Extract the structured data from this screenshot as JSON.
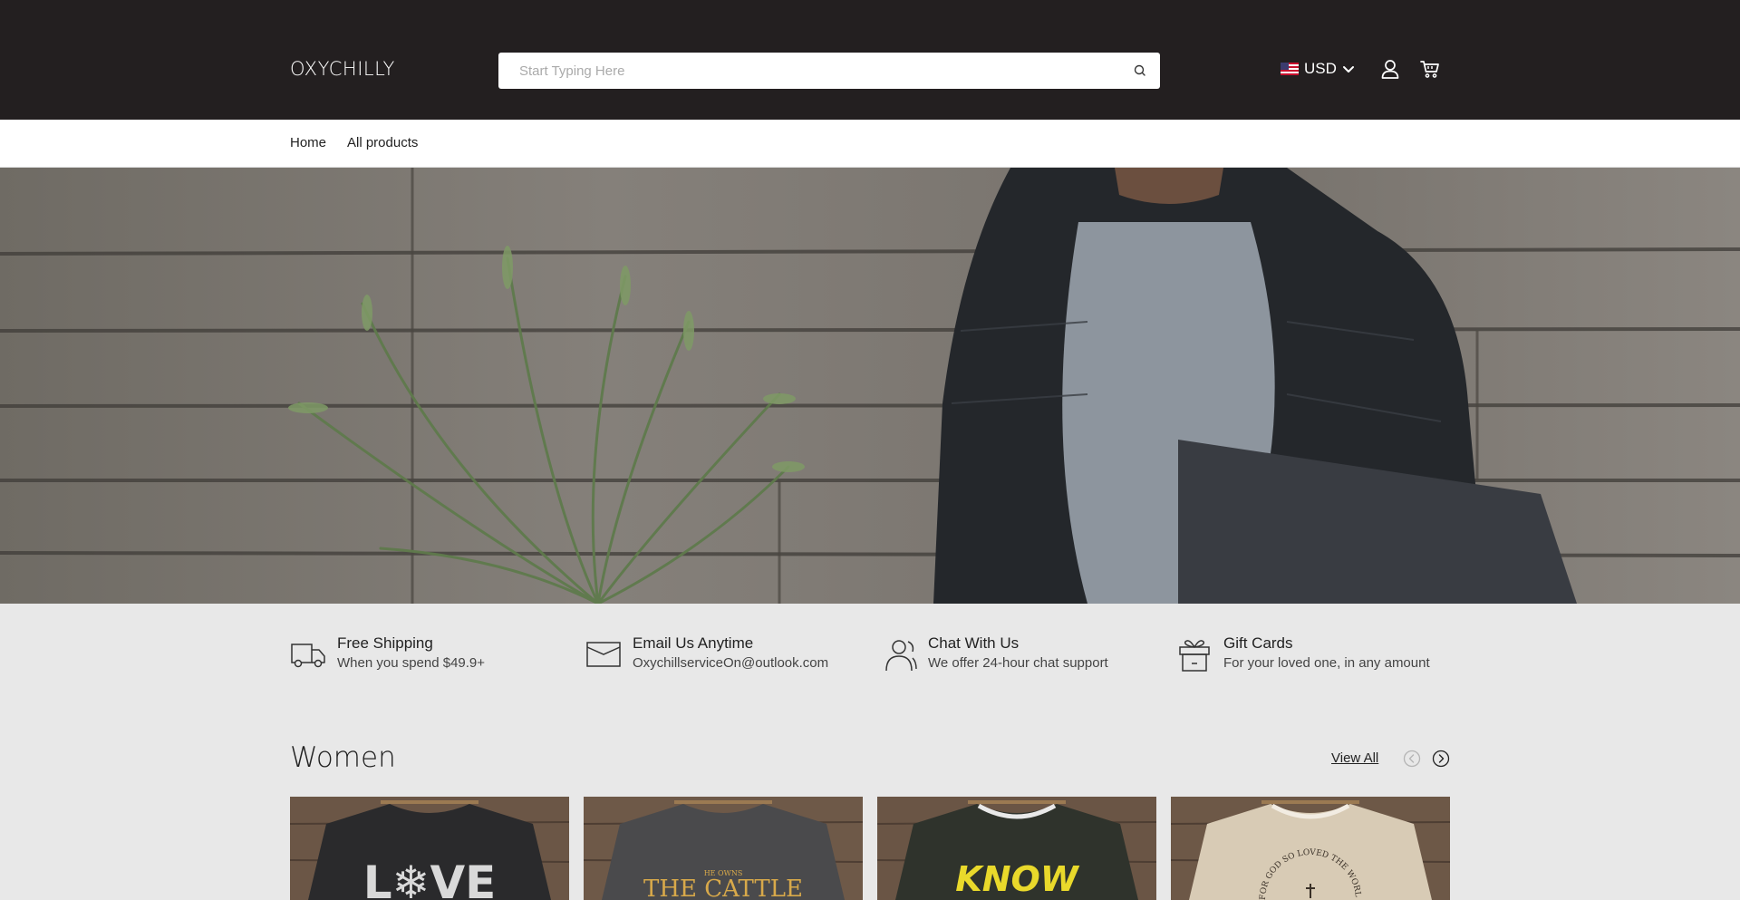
{
  "header": {
    "logo": "OXYCHILLY",
    "search_placeholder": "Start Typing Here",
    "currency": "USD"
  },
  "nav": {
    "items": [
      {
        "label": "Home"
      },
      {
        "label": "All products"
      }
    ]
  },
  "features": [
    {
      "icon": "truck-icon",
      "title": "Free Shipping",
      "subtitle": "When you spend $49.9+"
    },
    {
      "icon": "envelope-icon",
      "title": "Email Us Anytime",
      "subtitle": "OxychillserviceOn@outlook.com"
    },
    {
      "icon": "users-icon",
      "title": "Chat With Us",
      "subtitle": "We offer 24-hour chat support"
    },
    {
      "icon": "gift-icon",
      "title": "Gift Cards",
      "subtitle": "For your loved one, in any amount"
    }
  ],
  "women": {
    "title": "Women",
    "view_all": "View All"
  },
  "products": [
    {
      "print_text": "L❄VE",
      "shirt_color": "#2a2a2c",
      "print_color": "#d9d9d9"
    },
    {
      "print_text": "THE CATTLE",
      "print_small": "HE OWNS",
      "shirt_color": "#4a4a4c",
      "print_color": "#d8a94a"
    },
    {
      "print_text": "KNOW",
      "shirt_color": "#2f332c",
      "print_color": "#e9d92b"
    },
    {
      "print_text": "FOR GOD SO LOVED THE WORLD",
      "shirt_color": "#d8cbb5",
      "print_color": "#3a3128"
    }
  ],
  "colors": {
    "header_bg": "#231f20",
    "page_bg": "#e8e8e8"
  }
}
